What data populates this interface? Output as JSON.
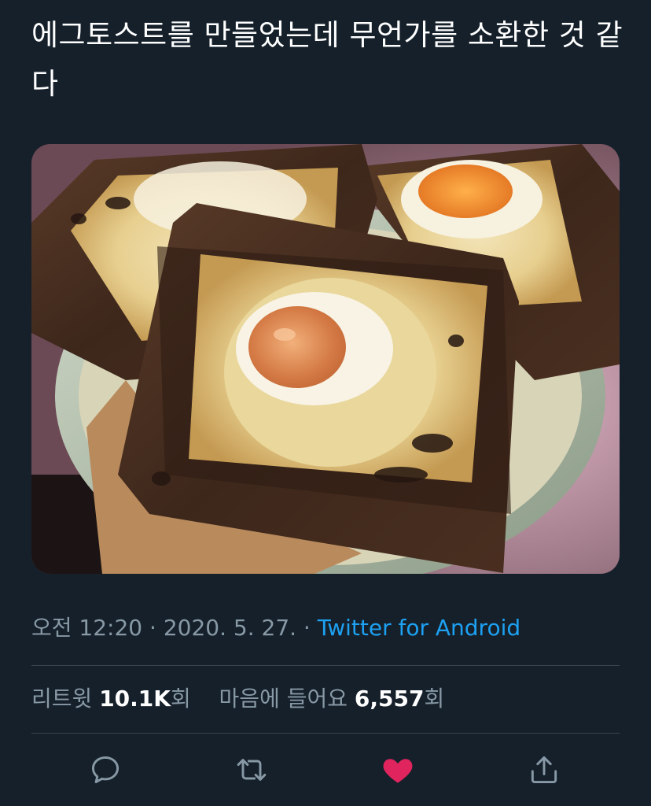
{
  "tweet": {
    "text": "에그토스트를 만들었는데 무언가를 소환한 것 같다"
  },
  "meta": {
    "time": "오전 12:20",
    "separator1": " · ",
    "date": "2020. 5. 27.",
    "separator2": " · ",
    "source": "Twitter for Android"
  },
  "stats": {
    "retweets_label": "리트윗",
    "retweets_count": "10.1K",
    "retweets_unit": "회",
    "likes_label": "마음에 들어요",
    "likes_count": "6,557",
    "likes_unit": "회"
  },
  "actions": {
    "reply_icon": "speech-bubble-icon",
    "retweet_icon": "retweet-arrows-icon",
    "like_icon": "heart-icon",
    "share_icon": "share-upload-icon",
    "like_active": true
  },
  "colors": {
    "background": "#15202b",
    "text_primary": "#ffffff",
    "text_secondary": "#8899a6",
    "link": "#1da1f2",
    "like": "#e0245e",
    "divider": "#38444d"
  }
}
